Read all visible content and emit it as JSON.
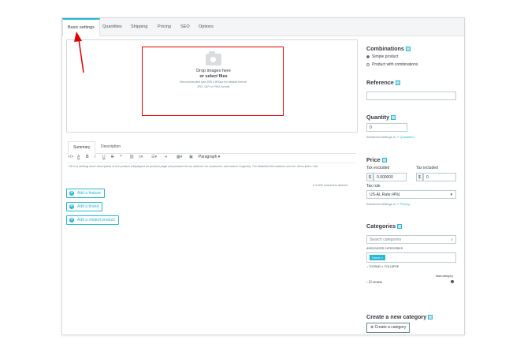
{
  "tabs": [
    {
      "label": "Basic settings",
      "active": true
    },
    {
      "label": "Quantities"
    },
    {
      "label": "Shipping"
    },
    {
      "label": "Pricing"
    },
    {
      "label": "SEO"
    },
    {
      "label": "Options"
    }
  ],
  "dropzone": {
    "line1": "Drop images here",
    "line2": "or select files",
    "line3": "Recommended size 800 x 800px for default theme.",
    "line4": "JPG, GIF or PNG format."
  },
  "editor": {
    "tab_summary": "Summary",
    "tab_description": "Description",
    "format_select": "Paragraph",
    "placeholder": "Fill in a striking short description of the product (displayed on product page and product list as abstract for customers and search engines). For detailed informations use the 'description' tab.",
    "counter": "0 of 800 characters allowed"
  },
  "buttons": {
    "add_feature": "Add a feature",
    "add_brand": "Add a brand",
    "add_related": "Add a related product"
  },
  "sidebar": {
    "combinations": {
      "title": "Combinations",
      "options": [
        "Simple product",
        "Product with combinations"
      ],
      "selected": 0
    },
    "reference": {
      "title": "Reference",
      "value": ""
    },
    "quantity": {
      "title": "Quantity",
      "value": "0",
      "advanced_prefix": "Advanced settings in",
      "advanced_link": "Quantities"
    },
    "price": {
      "title": "Price",
      "tax_excluded_label": "Tax excluded",
      "tax_included_label": "Tax included",
      "currency": "$",
      "tax_excluded_value": "0.000000",
      "tax_included_value": "0",
      "tax_rule_label": "Tax rule",
      "tax_rule_value": "US-AL Rate (4%)",
      "advanced_prefix": "Advanced settings in",
      "advanced_link": "Pricing"
    },
    "categories": {
      "title": "Categories",
      "search_placeholder": "Search categories",
      "associated_label": "ASSOCIATED CATEGORIES",
      "associated_tag": "Home",
      "expand": "EXPAND",
      "collapse": "COLLAPSE",
      "main_category_label": "Main category",
      "tree_item": "Home"
    },
    "new_category": {
      "title": "Create a new category",
      "button": "Create a category"
    }
  },
  "colors": {
    "accent": "#25b9d7",
    "annotation": "#e00000"
  }
}
